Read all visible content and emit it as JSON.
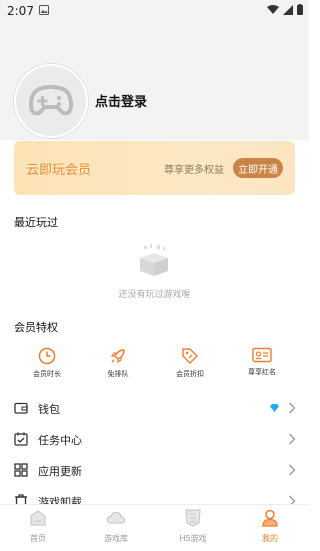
{
  "status_bar": {
    "time": "2:07"
  },
  "profile": {
    "login_text": "点击登录"
  },
  "vip_card": {
    "title": "云即玩会员",
    "subtitle": "尊享更多权益",
    "button": "立即开通"
  },
  "recent": {
    "title": "最近玩过",
    "empty_text": "还没有玩过游戏喔"
  },
  "privileges": {
    "title": "会员特权",
    "items": [
      {
        "label": "会员时长",
        "icon": "clock-icon"
      },
      {
        "label": "免排队",
        "icon": "rocket-icon"
      },
      {
        "label": "会员折扣",
        "icon": "tag-icon"
      },
      {
        "label": "尊享红名",
        "icon": "id-card-icon"
      }
    ]
  },
  "list": {
    "items": [
      {
        "label": "钱包",
        "icon": "wallet-icon"
      },
      {
        "label": "任务中心",
        "icon": "calendar-check-icon"
      },
      {
        "label": "应用更新",
        "icon": "grid-icon"
      },
      {
        "label": "游戏卸载",
        "icon": "trash-icon"
      }
    ]
  },
  "bottom_nav": {
    "items": [
      {
        "label": "首页"
      },
      {
        "label": "游戏库"
      },
      {
        "label": "H5游戏"
      },
      {
        "label": "我的"
      }
    ],
    "active_index": 3
  },
  "colors": {
    "accent": "#ef7d2d",
    "vip_button": "#c98446",
    "vip_text": "#e88f3d"
  }
}
